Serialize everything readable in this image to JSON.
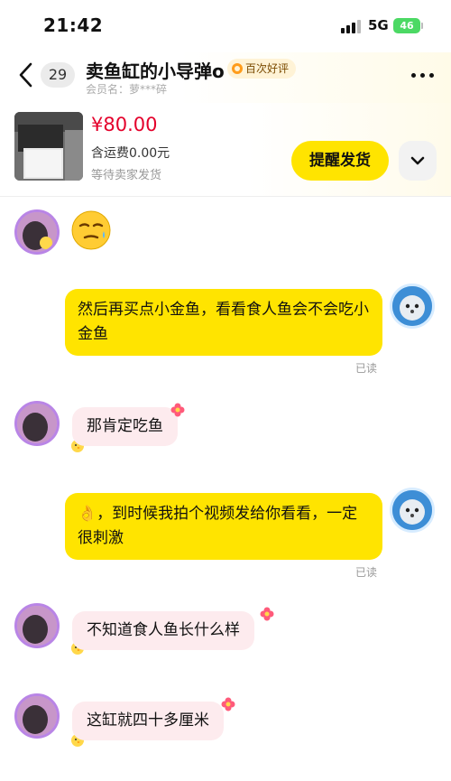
{
  "status_bar": {
    "time": "21:42",
    "network": "5G",
    "battery": "46"
  },
  "header": {
    "unread_count": "29",
    "seller_name": "卖鱼缸的小导弹o",
    "rating_badge": "百次好评",
    "member_name": "会员名：萝***碎"
  },
  "order": {
    "price": "¥80.00",
    "shipping": "含运费0.00元",
    "status": "等待卖家发货",
    "remind_button": "提醒发货"
  },
  "messages": [
    {
      "sender": "seller",
      "type": "emoji",
      "emoji": "😒"
    },
    {
      "sender": "me",
      "text": "然后再买点小金鱼，看看食人鱼会不会吃小金鱼",
      "status": "已读"
    },
    {
      "sender": "seller",
      "text": "那肯定吃鱼"
    },
    {
      "sender": "me",
      "text": "👌，到时候我拍个视频发给你看看，一定很刺激",
      "status": "已读"
    },
    {
      "sender": "seller",
      "text": "不知道食人鱼长什么样"
    },
    {
      "sender": "seller",
      "text": "这缸就四十多厘米"
    }
  ],
  "colors": {
    "accent_yellow": "#ffe400",
    "price_red": "#e4002b",
    "seller_bubble": "#fdebee"
  }
}
